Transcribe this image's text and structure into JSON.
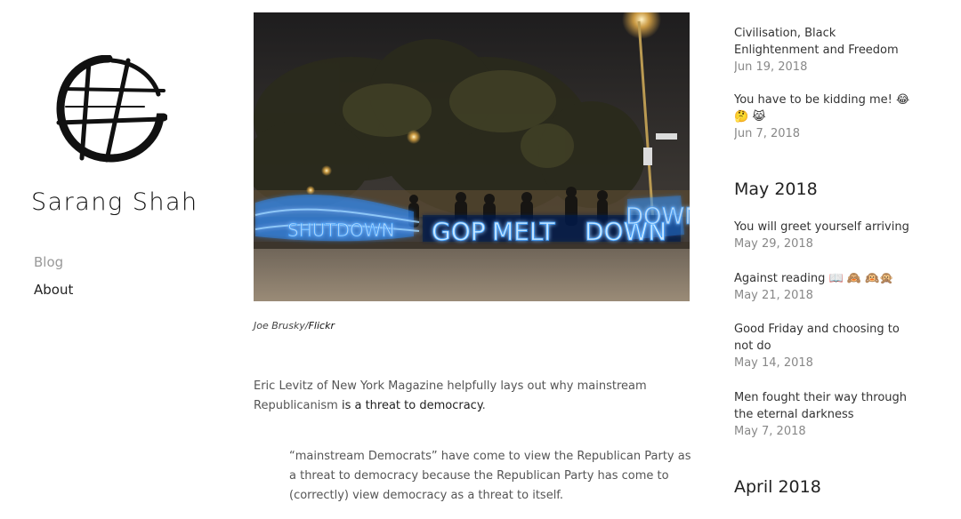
{
  "site": {
    "title": "Sarang Shah"
  },
  "nav": {
    "items": [
      {
        "label": "Blog",
        "active": true
      },
      {
        "label": "About",
        "active": false
      }
    ]
  },
  "article": {
    "caption_author": "Joe Brusky/",
    "caption_source": "Flickr",
    "paragraph_pre": "Eric Levitz of New York Magazine helpfully lays out why mainstream Republicanism ",
    "paragraph_link": "is a threat to democracy",
    "paragraph_post": ".",
    "quote": "“mainstream Democrats” have come to view the Republican Party as a threat to democracy because the Republican Party has come to (correctly) view democracy as a threat to itself.",
    "image_sign_words": [
      "SHUTDOWN",
      "GOP",
      "MELT",
      "DOWN",
      "DOWN"
    ]
  },
  "archive": {
    "posts_top": [
      {
        "title": "Civilisation, Black Enlightenment and Freedom",
        "date": "Jun 19, 2018"
      },
      {
        "title": "You have to be kidding me! 😂 🤔 😹",
        "date": "Jun 7, 2018"
      }
    ],
    "months": [
      {
        "label": "May 2018",
        "posts": [
          {
            "title": "You will greet yourself arriving",
            "date": "May 29, 2018"
          },
          {
            "title": "Against reading 📖 🙈 🙉🙊",
            "date": "May 21, 2018"
          },
          {
            "title": "Good Friday and choosing to not do",
            "date": "May 14, 2018"
          },
          {
            "title": "Men fought their way through the eternal darkness",
            "date": "May 7, 2018"
          }
        ]
      },
      {
        "label": "April 2018",
        "posts": []
      }
    ]
  }
}
